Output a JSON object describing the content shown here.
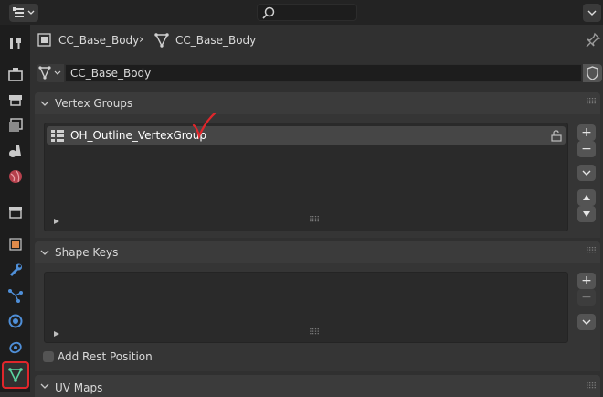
{
  "header": {
    "breadcrumb_object": "CC_Base_Body",
    "breadcrumb_separator": "›",
    "breadcrumb_data": "CC_Base_Body",
    "datablock_name": "CC_Base_Body"
  },
  "tabs": [
    "tool-icon",
    "render-icon",
    "output-icon",
    "view-layer-icon",
    "scene-icon",
    "world-icon",
    "collection-icon",
    "object-icon",
    "modifier-icon",
    "particles-icon",
    "physics-icon",
    "constraints-icon",
    "object-data-icon"
  ],
  "vertex_groups": {
    "title": "Vertex Groups",
    "items": [
      {
        "name": "OH_Outline_VertexGroup"
      }
    ],
    "annotation_color": "#e0262b"
  },
  "shape_keys": {
    "title": "Shape Keys"
  },
  "add_rest_position": {
    "label": "Add Rest Position",
    "checked": false
  },
  "uv_maps": {
    "title": "UV Maps"
  },
  "colors": {
    "active_tab_outline": "#e0262b",
    "data_icon_color": "#5bd6a2",
    "accent_orange": "#e08b4b",
    "accent_blue": "#4f8fd8"
  }
}
